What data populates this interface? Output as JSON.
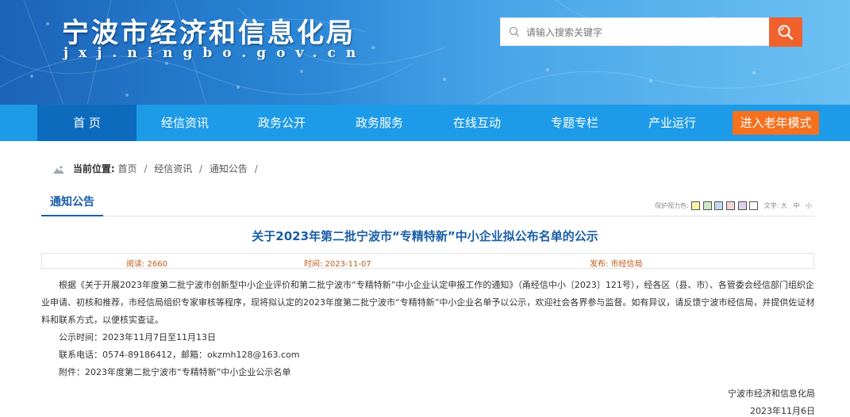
{
  "header": {
    "site_title": "宁波市经济和信息化局",
    "site_domain": "jxj.ningbo.gov.cn",
    "search_placeholder": "请输入搜索关键字"
  },
  "nav": {
    "items": [
      {
        "label": "首 页",
        "active": true
      },
      {
        "label": "经信资讯"
      },
      {
        "label": "政务公开"
      },
      {
        "label": "政务服务"
      },
      {
        "label": "在线互动"
      },
      {
        "label": "专题专栏"
      },
      {
        "label": "产业运行"
      }
    ],
    "elder_mode": "进入老年模式"
  },
  "breadcrumb": {
    "prefix": "当前位置:",
    "items": [
      "首页",
      "经信资讯",
      "通知公告"
    ],
    "sep": "/"
  },
  "section": {
    "tab": "通知公告",
    "eye_label": "保护视力色:",
    "eye_colors": [
      "#fff3a6",
      "#cfe8c2",
      "#c5d9f1",
      "#f6d4d4",
      "#e0d0ef",
      "#ffffff"
    ],
    "font_label": "文字:",
    "font_sizes": [
      "大",
      "中",
      "小"
    ]
  },
  "article": {
    "title": "关于2023年第二批宁波市“专精特新”中小企业拟公布名单的公示",
    "reads": "阅读: 2660",
    "time": "时间: 2023-11-07",
    "source": "发布: 市经信局",
    "paragraph1": "根据《关于开展2023年度第二批宁波市创新型中小企业评价和第二批宁波市“专精特新”中小企业认定申报工作的通知》（甬经信中小〔2023〕121号），经各区（县、市）、各管委会经信部门组织企业申请、初核和推荐，市经信局组织专家审核等程序，现将拟认定的2023年度第二批宁波市“专精特新”中小企业名单予以公示，欢迎社会各界参与监督。如有异议，请反馈宁波市经信局，并提供佐证材料和联系方式，以便核实查证。",
    "period": "公示时间：2023年11月7日至11月13日",
    "contact": "联系电话：0574-89186412，邮箱：okzmh128@163.com",
    "attachment": "附件：2023年度第二批宁波市“专精特新”中小企业公示名单",
    "signature": "宁波市经济和信息化局",
    "date": "2023年11月6日"
  }
}
